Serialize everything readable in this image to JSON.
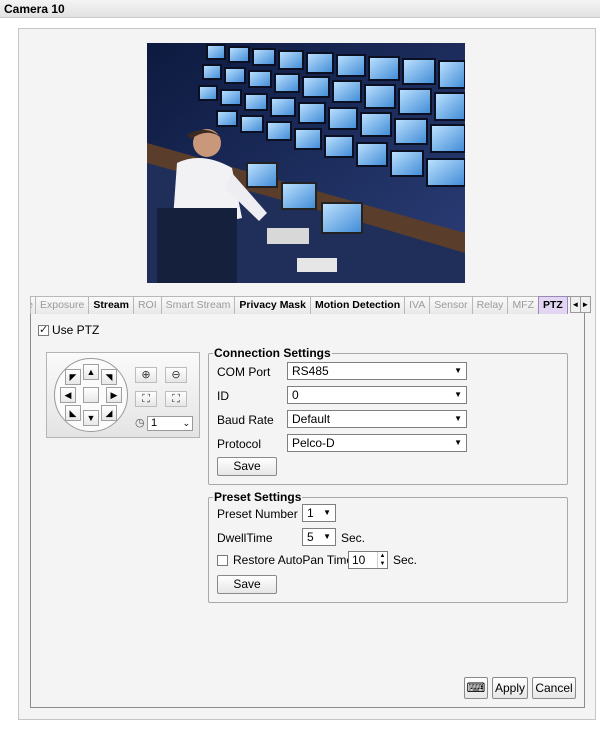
{
  "window": {
    "title": "Camera 10"
  },
  "tabs": {
    "items": [
      {
        "label": "rence",
        "state": "disabled"
      },
      {
        "label": "Exposure",
        "state": "disabled"
      },
      {
        "label": "Stream",
        "state": "enabled"
      },
      {
        "label": "ROI",
        "state": "disabled"
      },
      {
        "label": "Smart Stream",
        "state": "disabled"
      },
      {
        "label": "Privacy Mask",
        "state": "enabled"
      },
      {
        "label": "Motion Detection",
        "state": "enabled"
      },
      {
        "label": "IVA",
        "state": "disabled"
      },
      {
        "label": "Sensor",
        "state": "disabled"
      },
      {
        "label": "Relay",
        "state": "disabled"
      },
      {
        "label": "MFZ",
        "state": "disabled"
      },
      {
        "label": "PTZ",
        "state": "active"
      }
    ],
    "prev_icon": "◄",
    "next_icon": "►"
  },
  "use_ptz": {
    "label": "Use PTZ",
    "checked": true
  },
  "ptz_control": {
    "speed_value": "1",
    "icons": [
      "arrow-up-left",
      "arrow-up",
      "arrow-up-right",
      "arrow-left",
      "arrow-right",
      "arrow-down-left",
      "arrow-down",
      "arrow-down-right",
      "zoom-in",
      "zoom-out",
      "focus-near",
      "focus-far",
      "speed"
    ]
  },
  "connection": {
    "legend": "Connection Settings",
    "com_port_label": "COM Port",
    "com_port_value": "RS485",
    "id_label": "ID",
    "id_value": "0",
    "baud_label": "Baud Rate",
    "baud_value": "Default",
    "protocol_label": "Protocol",
    "protocol_value": "Pelco-D",
    "save_label": "Save"
  },
  "preset": {
    "legend": "Preset Settings",
    "number_label": "Preset Number",
    "number_value": "1",
    "dwell_label": "DwellTime",
    "dwell_value": "5",
    "dwell_unit": "Sec.",
    "restore_label": "Restore AutoPan Time",
    "restore_checked": false,
    "restore_value": "10",
    "restore_unit": "Sec.",
    "save_label": "Save"
  },
  "footer": {
    "apply_label": "Apply",
    "cancel_label": "Cancel",
    "keyboard_icon": "keyboard-icon"
  },
  "colors": {
    "active_tab": "#e2d6f2",
    "panel_bg": "#f4f4f4"
  }
}
